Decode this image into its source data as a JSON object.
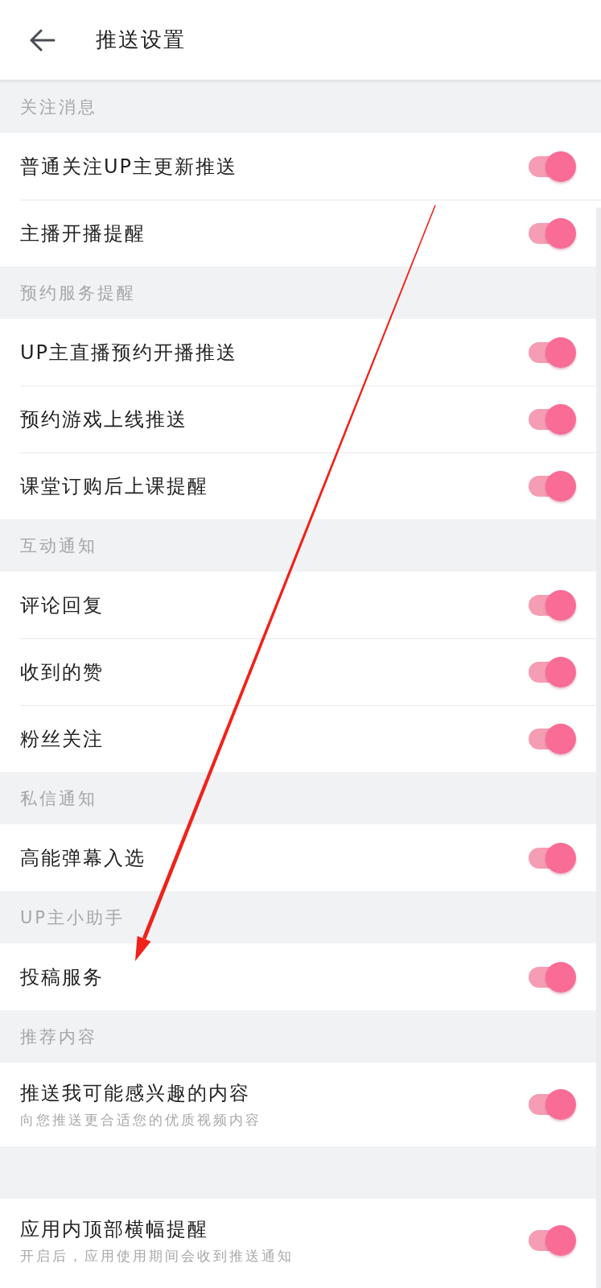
{
  "header": {
    "title": "推送设置"
  },
  "sections": [
    {
      "title": "关注消息",
      "items": [
        {
          "label": "普通关注UP主更新推送",
          "on": true
        },
        {
          "label": "主播开播提醒",
          "on": true
        }
      ]
    },
    {
      "title": "预约服务提醒",
      "items": [
        {
          "label": "UP主直播预约开播推送",
          "on": true
        },
        {
          "label": "预约游戏上线推送",
          "on": true
        },
        {
          "label": "课堂订购后上课提醒",
          "on": true
        }
      ]
    },
    {
      "title": "互动通知",
      "items": [
        {
          "label": "评论回复",
          "on": true
        },
        {
          "label": "收到的赞",
          "on": true
        },
        {
          "label": "粉丝关注",
          "on": true
        }
      ]
    },
    {
      "title": "私信通知",
      "items": [
        {
          "label": "高能弹幕入选",
          "on": true
        }
      ]
    },
    {
      "title": "UP主小助手",
      "items": [
        {
          "label": "投稿服务",
          "on": true
        }
      ]
    },
    {
      "title": "推荐内容",
      "items": [
        {
          "label": "推送我可能感兴趣的内容",
          "description": "向您推送更合适您的优质视频内容",
          "on": true
        }
      ]
    },
    {
      "items": [
        {
          "label": "应用内顶部横幅提醒",
          "description": "开启后，应用使用期间会收到推送通知",
          "on": true
        }
      ]
    }
  ]
}
